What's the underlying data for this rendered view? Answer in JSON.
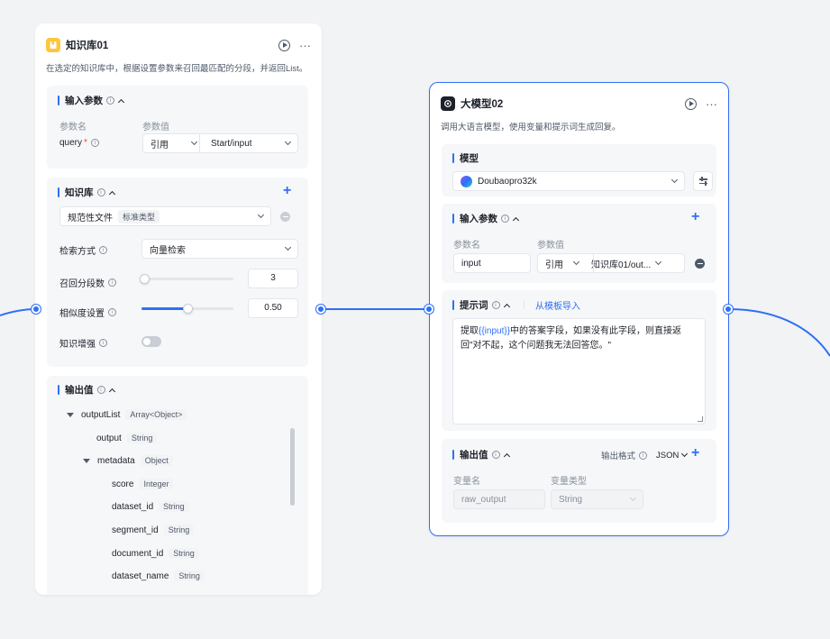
{
  "colors": {
    "accent": "#2e6ff5",
    "canvas": "#f2f3f5",
    "kb_icon": "#ffc53d",
    "llm_icon": "#1d2129"
  },
  "kb_node": {
    "title": "知识库01",
    "description": "在选定的知识库中，根据设置参数来召回最匹配的分段，并返回List。",
    "input": {
      "title": "输入参数",
      "col_name": "参数名",
      "col_value": "参数值",
      "param_name": "query",
      "required_mark": "*",
      "ref_type": "引用",
      "ref_value": "Start/input"
    },
    "knowledge": {
      "title": "知识库",
      "kb_name": "规范性文件",
      "kb_type": "标准类型",
      "search_mode_label": "检索方式",
      "search_mode_value": "向量检索",
      "recall_label": "召回分段数",
      "recall_value": "3",
      "recall_fraction": 0.03,
      "similarity_label": "相似度设置",
      "similarity_value": "0.50",
      "similarity_fraction": 0.5,
      "enhance_label": "知识增强",
      "enhance_on": false
    },
    "output": {
      "title": "输出值",
      "tree": [
        {
          "name": "outputList",
          "type": "Array<Object>"
        },
        {
          "name": "output",
          "type": "String"
        },
        {
          "name": "metadata",
          "type": "Object"
        },
        {
          "name": "score",
          "type": "Integer"
        },
        {
          "name": "dataset_id",
          "type": "String"
        },
        {
          "name": "segment_id",
          "type": "String"
        },
        {
          "name": "document_id",
          "type": "String"
        },
        {
          "name": "dataset_name",
          "type": "String"
        }
      ]
    }
  },
  "llm_node": {
    "title": "大模型02",
    "description": "调用大语言模型，使用变量和提示词生成回复。",
    "model": {
      "title": "模型",
      "name": "Doubaopro32k"
    },
    "input": {
      "title": "输入参数",
      "col_name": "参数名",
      "col_value": "参数值",
      "param_name": "input",
      "ref_type": "引用",
      "ref_value": "知识库01/out..."
    },
    "prompt": {
      "title": "提示词",
      "template_link": "从模板导入",
      "text_before": "提取",
      "variable": "{{input}}",
      "text_after": "中的答案字段，如果没有此字段，则直接返回\"对不起，这个问题我无法回答您。\""
    },
    "output": {
      "title": "输出值",
      "format_label": "输出格式",
      "format_value": "JSON",
      "col_name": "变量名",
      "col_type": "变量类型",
      "var_name": "raw_output",
      "var_type": "String"
    }
  }
}
